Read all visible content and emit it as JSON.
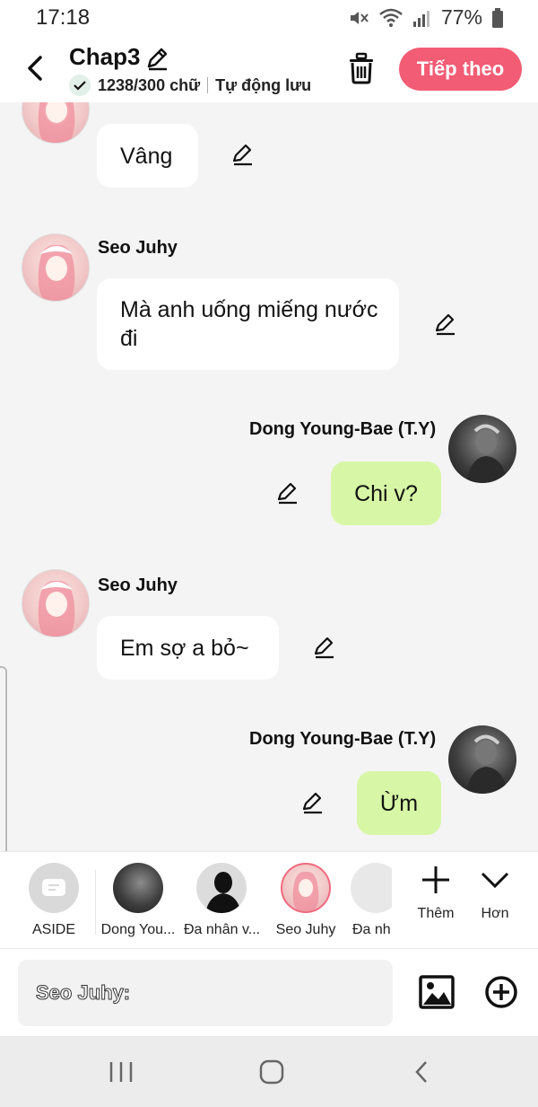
{
  "status_bar": {
    "time": "17:18",
    "battery": "77%"
  },
  "header": {
    "title": "Chap3",
    "word_count": "1238/300 chữ",
    "autosave": "Tự động lưu",
    "next_button": "Tiếp theo",
    "icons": {
      "back": "chevron-left-icon",
      "edit": "pencil-icon",
      "delete": "trash-icon",
      "saved": "check-icon"
    }
  },
  "messages": [
    {
      "side": "left",
      "sender": "",
      "text": "Vâng"
    },
    {
      "side": "left",
      "sender": "Seo Juhy",
      "text": "Mà anh uống miếng nước đi"
    },
    {
      "side": "right",
      "sender": "Dong Young-Bae (T.Y)",
      "text": "Chi v?"
    },
    {
      "side": "left",
      "sender": "Seo Juhy",
      "text": "Em sợ a bỏ~"
    },
    {
      "side": "right",
      "sender": "Dong Young-Bae (T.Y)",
      "text": "Ừm"
    }
  ],
  "characters": [
    {
      "label": "ASIDE"
    },
    {
      "label": "Dong You..."
    },
    {
      "label": "Đa nhân v..."
    },
    {
      "label": "Seo Juhy"
    },
    {
      "label": "Đa nh..."
    }
  ],
  "char_actions": {
    "add": "Thêm",
    "more": "Hơn"
  },
  "input": {
    "placeholder": "Seo Juhy:"
  },
  "colors": {
    "accent": "#f25c74",
    "right_bubble": "#d7f7a6",
    "left_bubble": "#ffffff",
    "background": "#f4f4f4"
  }
}
